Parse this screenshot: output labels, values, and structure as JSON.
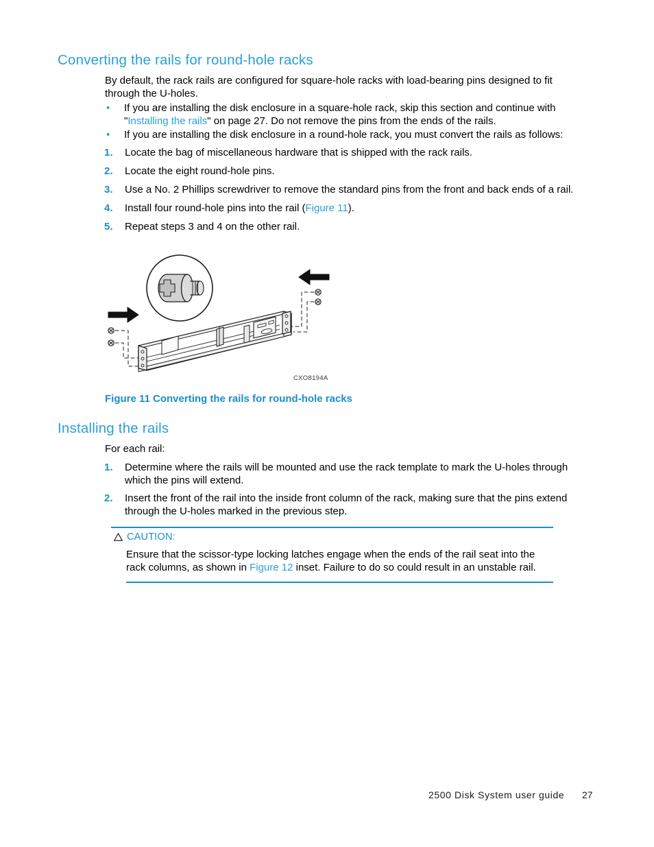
{
  "colors": {
    "heading_blue": "#2b9fd6",
    "accent_blue": "#1a8fc8",
    "body_black": "#000000"
  },
  "sections": {
    "converting": {
      "heading": "Converting the rails for round-hole racks",
      "intro": "By default, the rack rails are configured for square-hole racks with load-bearing pins designed to fit through the U-holes.",
      "bullets": [
        {
          "mark": "•",
          "text_before": "If you are installing the disk enclosure in a square-hole rack, skip this section and continue with \"",
          "xref": "Installing the rails",
          "text_after": "\" on page 27. Do not remove the pins from the ends of the rails."
        },
        {
          "mark": "•",
          "text_before": "If you are installing the disk enclosure in a round-hole rack, you must convert the rails as follows:",
          "xref": "",
          "text_after": ""
        }
      ],
      "steps": [
        {
          "num": "1.",
          "text_before": "Locate the bag of miscellaneous hardware that is shipped with the rack rails.",
          "xref": "",
          "text_after": ""
        },
        {
          "num": "2.",
          "text_before": "Locate the eight round-hole pins.",
          "xref": "",
          "text_after": ""
        },
        {
          "num": "3.",
          "text_before": "Use a No. 2 Phillips screwdriver to remove the standard pins from the front and back ends of a rail.",
          "xref": "",
          "text_after": ""
        },
        {
          "num": "4.",
          "text_before": "Install four round-hole pins into the rail (",
          "xref": "Figure 11",
          "text_after": ")."
        },
        {
          "num": "5.",
          "text_before": "Repeat steps 3 and 4 on the other rail.",
          "xref": "",
          "text_after": ""
        }
      ]
    },
    "figure": {
      "id_label": "CXO8194A",
      "caption": "Figure 11 Converting the rails for round-hole racks",
      "caption_number": "Figure 11",
      "caption_title": "Converting the rails for round-hole racks"
    },
    "installing": {
      "heading": "Installing the rails",
      "lead": "For each rail:",
      "steps": [
        {
          "num": "1.",
          "text_before": "Determine where the rails will be mounted and use the rack template to mark the U-holes through which the pins will extend.",
          "xref": "",
          "text_after": ""
        },
        {
          "num": "2.",
          "text_before": "Insert the front of the rail into the inside front column of the rack, making sure that the pins extend through the U-holes marked in the previous step.",
          "xref": "",
          "text_after": ""
        }
      ]
    },
    "caution": {
      "label": "CAUTION:",
      "icon": "warning-triangle-icon",
      "text_before": "Ensure that the scissor-type locking latches engage when the ends of the rail seat into the rack columns, as shown in ",
      "xref": "Figure 12",
      "text_after": " inset. Failure to do so could result in an unstable rail."
    }
  },
  "footer": {
    "guide_title": "2500 Disk System user guide",
    "page_number": "27"
  }
}
